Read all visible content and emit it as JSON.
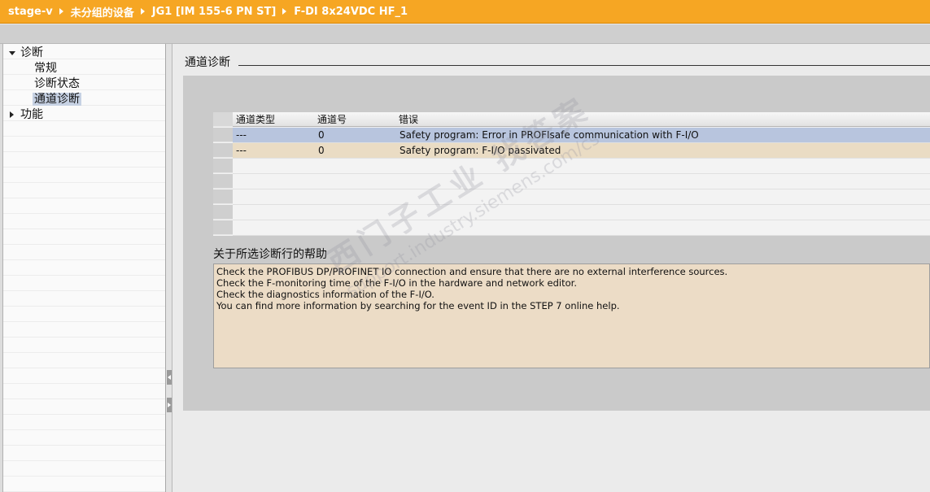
{
  "breadcrumb": [
    "stage-v",
    "未分组的设备",
    "JG1 [IM 155-6 PN ST]",
    "F-DI 8x24VDC HF_1"
  ],
  "nav": {
    "diagnostics": "诊断",
    "general": "常规",
    "diag_status": "诊断状态",
    "channel_diag": "通道诊断",
    "functions": "功能"
  },
  "section_title": "通道诊断",
  "table": {
    "headers": [
      "通道类型",
      "通道号",
      "错误"
    ],
    "rows": [
      {
        "type": "---",
        "number": "0",
        "error": "Safety program: Error in PROFIsafe communication with F-I/O",
        "state": "selected"
      },
      {
        "type": "---",
        "number": "0",
        "error": "Safety program: F-I/O passivated",
        "state": "error"
      }
    ]
  },
  "help": {
    "title": "关于所选诊断行的帮助",
    "lines": [
      "Check the PROFIBUS DP/PROFINET IO connection and ensure that there are no external interference sources.",
      "Check the F-monitoring time of the F-I/O in the hardware and network editor.",
      "Check the diagnostics information of the F-I/O.",
      "You can find more information by searching for the event ID in the STEP 7 online help."
    ]
  },
  "watermark": {
    "text": "西门子工业 找答案",
    "url": "support.industry.siemens.com/cs"
  },
  "colors": {
    "topbar": "#f6a623",
    "selected_row": "#b8c5de",
    "error_row": "#eadcc4",
    "help_bg": "#ecdcc6"
  }
}
